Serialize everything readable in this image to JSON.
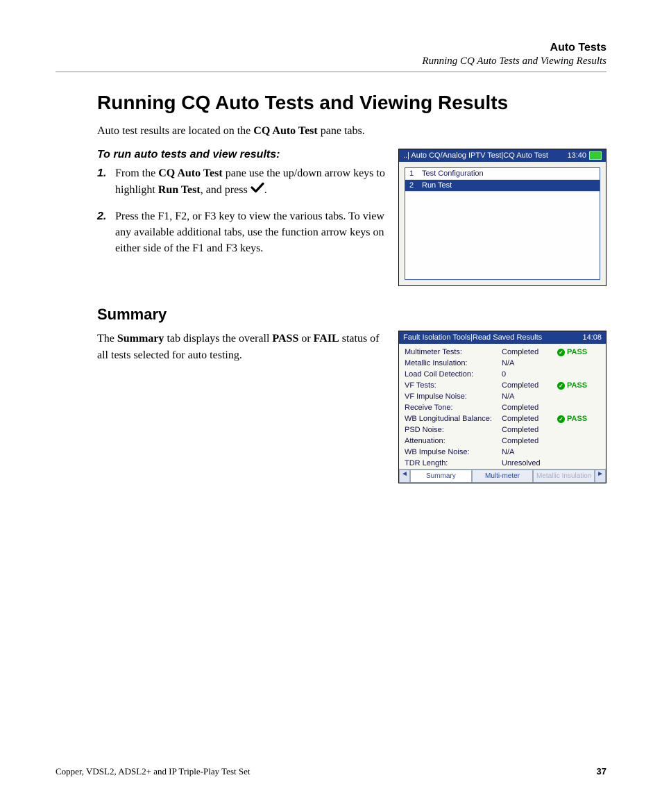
{
  "header": {
    "title": "Auto Tests",
    "subtitle": "Running CQ Auto Tests and Viewing Results"
  },
  "h1": "Running CQ Auto Tests and Viewing Results",
  "intro_pre": "Auto test results are located on the ",
  "intro_bold": "CQ Auto Test",
  "intro_post": " pane tabs.",
  "steps_heading": "To run auto tests and view results:",
  "step1": {
    "num": "1.",
    "a": "From the ",
    "b1": "CQ Auto Test",
    "c": " pane use the up/down arrow keys to highlight ",
    "b2": "Run Test",
    "d": ", and press ",
    "e": "."
  },
  "step2": {
    "num": "2.",
    "text": "Press the F1, F2, or F3 key to view the various tabs. To view any available additional tabs, use the function arrow keys on either side of the F1 and F3 keys."
  },
  "device1": {
    "title": "..| Auto CQ/Analog IPTV Test|CQ Auto Test",
    "time": "13:40",
    "rows": [
      {
        "idx": "1",
        "label": "Test Configuration",
        "selected": false
      },
      {
        "idx": "2",
        "label": "Run Test",
        "selected": true
      }
    ]
  },
  "h2": "Summary",
  "summary_para": {
    "a": "The ",
    "b1": "Summary",
    "c": " tab displays the overall ",
    "b2": "PASS",
    "d": " or ",
    "b3": "FAIL",
    "e": " status of all tests selected for auto testing."
  },
  "device2": {
    "title": "Fault Isolation Tools|Read Saved Results",
    "time": "14:08",
    "items": [
      {
        "label": "Multimeter Tests:",
        "value": "Completed",
        "pass": true
      },
      {
        "label": "Metallic Insulation:",
        "value": "N/A",
        "pass": false
      },
      {
        "label": "Load Coil Detection:",
        "value": "0",
        "pass": false
      },
      {
        "label": "VF Tests:",
        "value": "Completed",
        "pass": true
      },
      {
        "label": "VF Impulse Noise:",
        "value": "N/A",
        "pass": false
      },
      {
        "label": "Receive Tone:",
        "value": "Completed",
        "pass": false
      },
      {
        "label": "WB Longitudinal Balance:",
        "value": "Completed",
        "pass": true
      },
      {
        "label": "PSD Noise:",
        "value": "Completed",
        "pass": false
      },
      {
        "label": "Attenuation:",
        "value": "Completed",
        "pass": false
      },
      {
        "label": "WB Impulse Noise:",
        "value": "N/A",
        "pass": false
      },
      {
        "label": "TDR Length:",
        "value": "Unresolved",
        "pass": false
      }
    ],
    "pass_label": "PASS",
    "tabs": {
      "left_arrow": "◄",
      "t1": "Summary",
      "t2": "Multi-meter",
      "t3": "Metallic Insulation",
      "right_arrow": "►"
    }
  },
  "footer": {
    "left": "Copper, VDSL2, ADSL2+ and IP Triple-Play Test Set",
    "page": "37"
  }
}
